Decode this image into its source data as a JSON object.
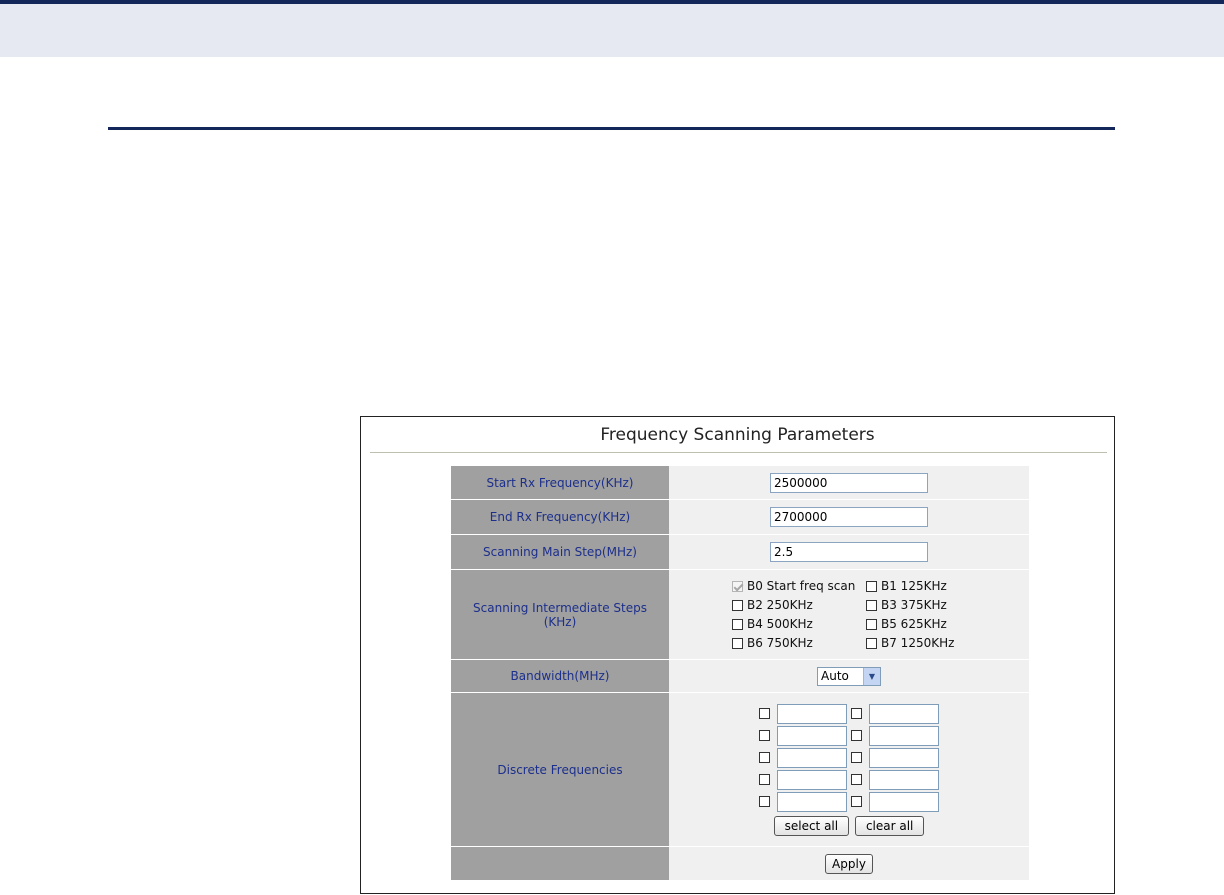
{
  "panel": {
    "title": "Frequency Scanning Parameters",
    "fields": {
      "start_rx": {
        "label": "Start Rx Frequency(KHz)",
        "value": "2500000"
      },
      "end_rx": {
        "label": "End Rx Frequency(KHz)",
        "value": "2700000"
      },
      "main_step": {
        "label": "Scanning Main Step(MHz)",
        "value": "2.5"
      },
      "intermediate": {
        "label_line1": "Scanning Intermediate Steps",
        "label_line2": "(KHz)",
        "options": [
          {
            "label": "B0 Start freq scan",
            "checked": true,
            "disabled": true
          },
          {
            "label": "B1 125KHz",
            "checked": false
          },
          {
            "label": "B2 250KHz",
            "checked": false
          },
          {
            "label": "B3 375KHz",
            "checked": false
          },
          {
            "label": "B4 500KHz",
            "checked": false
          },
          {
            "label": "B5 625KHz",
            "checked": false
          },
          {
            "label": "B6 750KHz",
            "checked": false
          },
          {
            "label": "B7 1250KHz",
            "checked": false
          }
        ]
      },
      "bandwidth": {
        "label": "Bandwidth(MHz)",
        "selected": "Auto"
      },
      "discrete": {
        "label": "Discrete Frequencies",
        "rows": 5,
        "columns": 2
      }
    },
    "buttons": {
      "select_all": "select all",
      "clear_all": "clear all",
      "apply": "Apply"
    }
  },
  "colors": {
    "header_band": "#e6e9f1",
    "header_rule": "#14275a",
    "label_bg": "#a0a0a0",
    "label_text": "#1c2f8c",
    "value_bg": "#f0f0f0"
  }
}
